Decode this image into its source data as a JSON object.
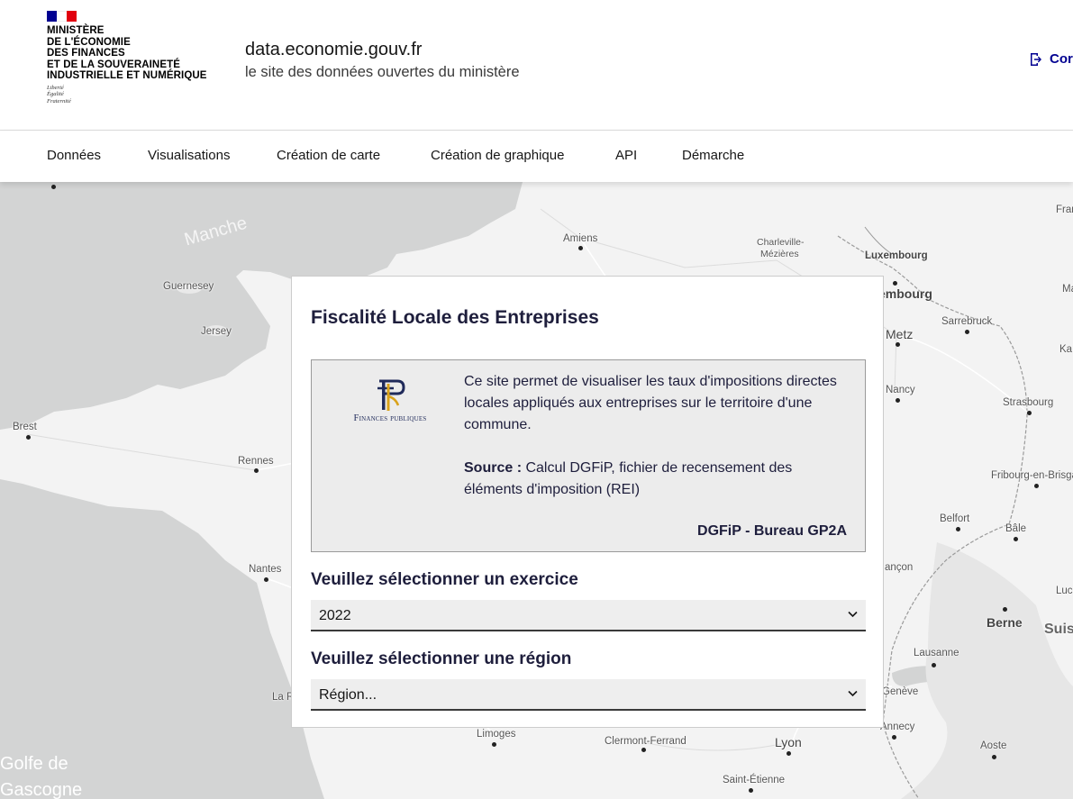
{
  "header": {
    "ministry_lines": [
      "Ministère",
      "de l'Économie",
      "des Finances",
      "et de la Souveraineté",
      "industrielle et numérique"
    ],
    "devise": [
      "Liberté",
      "Égalité",
      "Fraternité"
    ],
    "site_title": "data.economie.gouv.fr",
    "site_tagline": "le site des données ouvertes du ministère",
    "connect_label": "Cor"
  },
  "nav": {
    "items": [
      "Données",
      "Visualisations",
      "Création de carte",
      "Création de graphique",
      "API",
      "Démarche"
    ]
  },
  "map": {
    "labels": [
      "Manche",
      "Guernesey",
      "Jersey",
      "Brest",
      "Rennes",
      "Nantes",
      "La R",
      "Golfe de",
      "Gascogne",
      "Amiens",
      "Charleville-",
      "Mézières",
      "Luxembourg",
      "embourg",
      "Metz",
      "Sarrebruck",
      "Nancy",
      "Strasbourg",
      "Fribourg-en-Brisga",
      "Belfort",
      "Bâle",
      "ançon",
      "Luc",
      "Berne",
      "Suis",
      "Lausanne",
      "Genève",
      "Annecy",
      "Aoste",
      "Limoges",
      "Clermont-Ferrand",
      "Lyon",
      "Saint-Étienne",
      "Fran",
      "Ma",
      "Ka"
    ]
  },
  "panel": {
    "title": "Fiscalité Locale des Entreprises",
    "logo_text": "Finances publiques",
    "description": "Ce site permet de visualiser les taux d'impositions directes locales appliqués aux entreprises sur le territoire d'une commune.",
    "source_label": "Source :",
    "source_text": " Calcul DGFiP, fichier de recensement des éléments d'imposition (REI)",
    "author": "DGFiP - Bureau GP2A",
    "exercice_label": "Veuillez sélectionner un exercice",
    "exercice_value": "2022",
    "region_label": "Veuillez sélectionner une région",
    "region_value": "Région..."
  }
}
